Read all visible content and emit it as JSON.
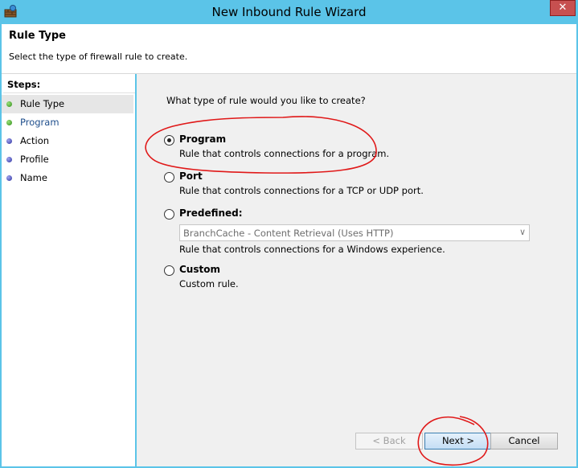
{
  "window": {
    "title": "New Inbound Rule Wizard",
    "close_glyph": "✕"
  },
  "header": {
    "title": "Rule Type",
    "description": "Select the type of firewall rule to create."
  },
  "steps": {
    "label": "Steps:",
    "items": [
      {
        "label": "Rule Type",
        "status": "completed"
      },
      {
        "label": "Program",
        "status": "completed"
      },
      {
        "label": "Action",
        "status": "pending"
      },
      {
        "label": "Profile",
        "status": "pending"
      },
      {
        "label": "Name",
        "status": "pending"
      }
    ]
  },
  "content": {
    "question": "What type of rule would you like to create?",
    "options": [
      {
        "label": "Program",
        "description": "Rule that controls connections for a program.",
        "selected": true
      },
      {
        "label": "Port",
        "description": "Rule that controls connections for a TCP or UDP port.",
        "selected": false
      },
      {
        "label": "Predefined:",
        "description": "Rule that controls connections for a Windows experience.",
        "selected": false
      },
      {
        "label": "Custom",
        "description": "Custom rule.",
        "selected": false
      }
    ],
    "predefined_select_value": "BranchCache - Content Retrieval (Uses HTTP)"
  },
  "buttons": {
    "back": "< Back",
    "next": "Next >",
    "cancel": "Cancel"
  },
  "colors": {
    "titlebar": "#5bc4e8",
    "annotation": "#e01818"
  }
}
